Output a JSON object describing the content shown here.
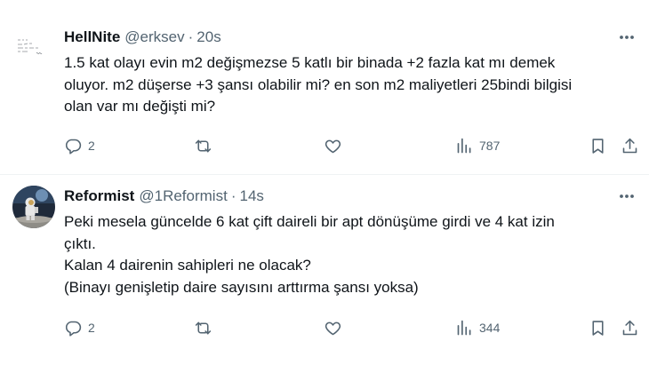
{
  "tweets": [
    {
      "name": "HellNite",
      "handle": "@erksev",
      "separator": "·",
      "time": "20s",
      "lines": [
        "1.5 kat olayı evin m2 değişmezse 5 katlı bir binada +2 fazla kat mı demek",
        "oluyor. m2 düşerse +3 şansı olabilir mi? en son m2 maliyetleri 25bindi bilgisi",
        "olan var mı değişti mi?"
      ],
      "replies": "2",
      "views": "787"
    },
    {
      "name": "Reformist",
      "handle": "@1Reformist",
      "separator": "·",
      "time": "14s",
      "lines": [
        "Peki mesela güncelde 6 kat çift daireli bir apt dönüşüme girdi ve 4 kat izin",
        "çıktı.",
        "Kalan 4 dairenin sahipleri ne olacak?",
        "(Binayı genişletip daire sayısını arttırma şansı yoksa)"
      ],
      "replies": "2",
      "views": "344"
    }
  ],
  "icons": {
    "reply": "reply-icon",
    "repost": "repost-icon",
    "like": "heart-icon",
    "views": "views-icon",
    "bookmark": "bookmark-icon",
    "share": "share-icon",
    "more": "more-icon"
  },
  "colors": {
    "text": "#0f1419",
    "secondary": "#536471",
    "divider": "#eff3f4",
    "background": "#ffffff"
  }
}
